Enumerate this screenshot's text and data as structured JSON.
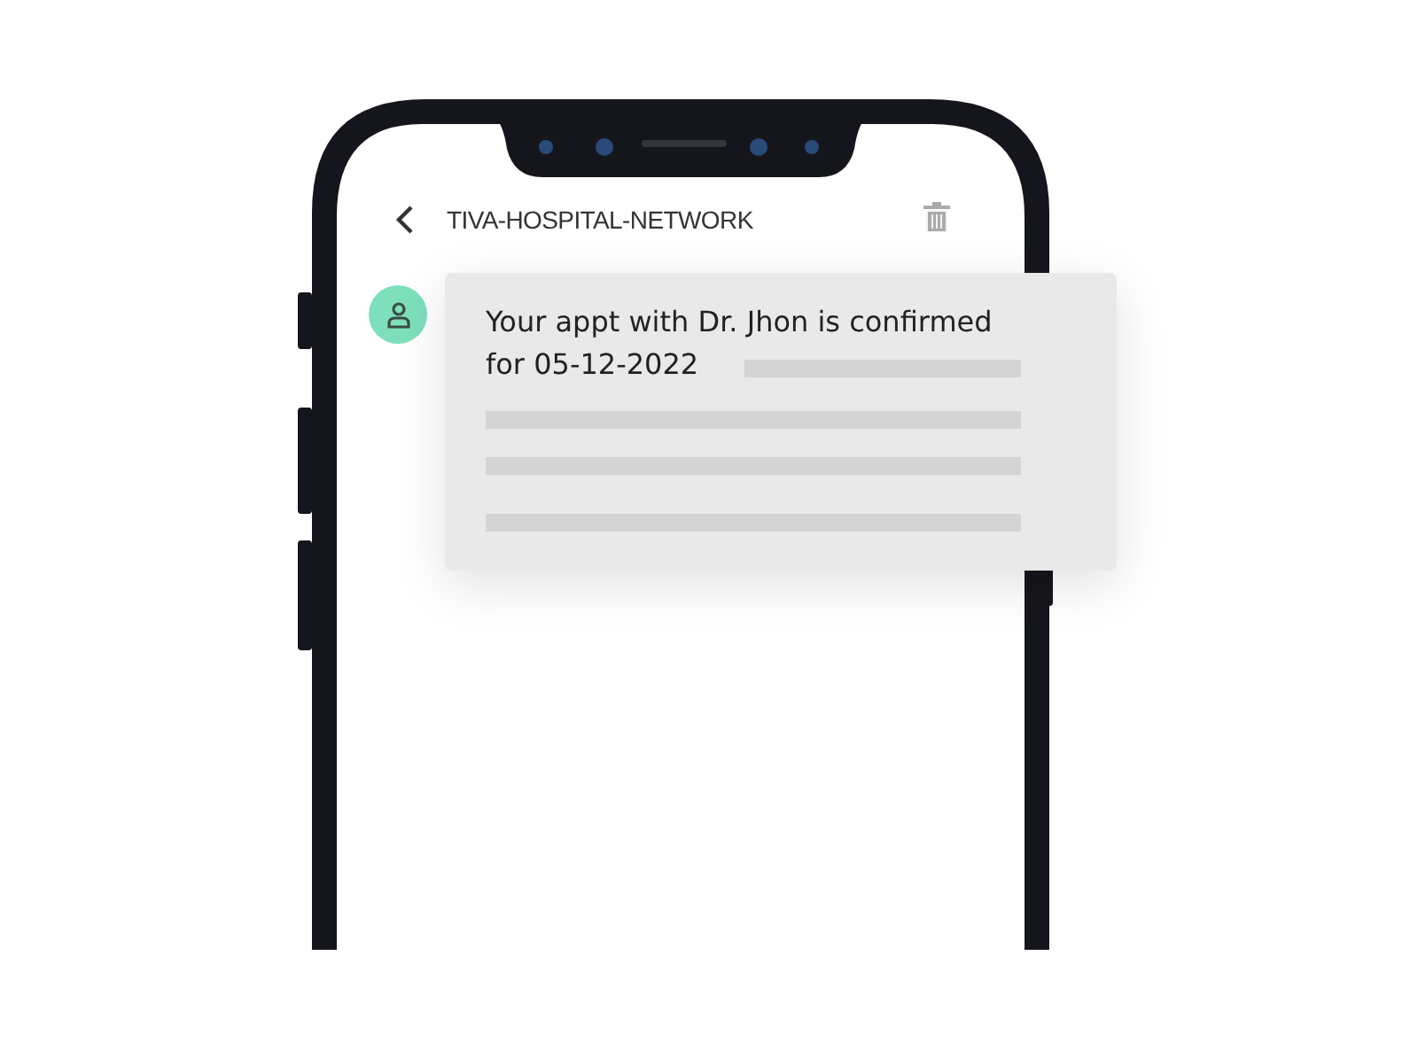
{
  "header": {
    "title": "TIVA-HOSPITAL-NETWORK"
  },
  "message": {
    "lines": [
      "Your appt with Dr. Jhon is confirmed",
      "for 05-12-2022"
    ]
  }
}
